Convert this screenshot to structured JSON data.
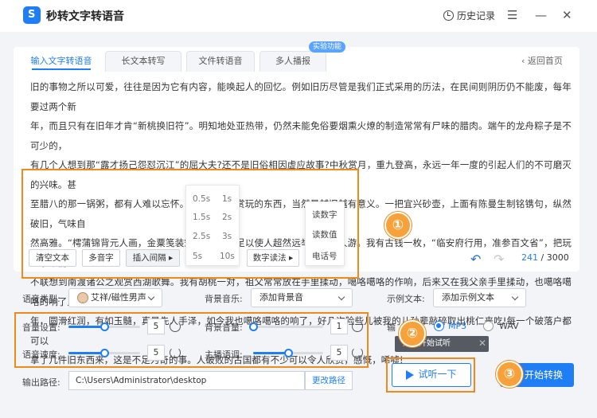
{
  "app": {
    "title": "秒转文字转语音",
    "logo_char": "S"
  },
  "header": {
    "history": "历史记录",
    "menu": "☰",
    "minimize": "—",
    "close": "✕"
  },
  "tabs": [
    {
      "label": "输入文字转语音"
    },
    {
      "label": "长文本转写"
    },
    {
      "label": "文件转语音"
    },
    {
      "label": "多人播报"
    }
  ],
  "badge": "实验功能",
  "back_home": "返回首页",
  "article": {
    "lines": [
      "旧的事物之所以可爱，往往是因为它有内容，能唤起人的回忆。例如旧历尽管是我们正式采用的历法，在民间则阴历仍不能废，每年要过两个新",
      "年，而且只有在旧年才肯“新桃换旧符”。明知地处亚热带，仍然未能免俗要烟熏火燎的制造常常有尸味的腊肉。端午的龙舟粽子是不可少的，",
      "有几个人想到那“露才扬己怨怼沉江”的屈大夫?还不是旧俗相因虚应故事?中秋赏月，重九登高，永远一年一度的引起人们的不可磨灭的兴味。甚",
      "至腊八的那一锅粥，都有人难以忘怀。至于供个人赏玩的东西，当然是越旧越有意义。一把宜兴砂壶，上面有陈曼生制铭镌句，纵然破旧，气味自",
      "然高雅。“樗蒲锦背元人画，金粟笺装宋版书”更是足以使人超然远举，与古人游。我有古钱一枚，“临安府行用，准参百文省”，把玩之余不能",
      "不联想到南渡诸公之观赏西湖歌舞。我有胡桃一对，祖父常常放在手里揉动，噶咯噶咯的作响，后来又在我父亲手里揉动，也噶咯噶咯的响了几十",
      "年，圆滑红润，有如玉髓，真是先人手泽，如今我也噶咯噶咯的响了，好几次险些儿被我的儿孙辈敲碎取出桃仁来吃!每一个破落户都可以",
      "拿了几件旧东西来，这是不足为奇的事。人破败的古国都有不少可以令人欣赏，感慨，唏嘘!"
    ]
  },
  "editor_buttons": {
    "clear": "清空文本",
    "polyphone": "多音字",
    "insert_pause": "插入间隔 ▸",
    "digit_read": "数字读法 ▸"
  },
  "pause_menu": {
    "items": [
      "0.5s",
      "1s",
      "1.5s",
      "2s",
      "2.5s",
      "3s",
      "5s",
      "10s"
    ]
  },
  "digit_menu": {
    "items": [
      "读数字",
      "读数值",
      "电话号"
    ]
  },
  "annotations": {
    "one": "①",
    "two": "②",
    "three": "③"
  },
  "editor_tools": {
    "undo": "↶",
    "redo": "↷",
    "count_current": "241",
    "count_max": " / 3000"
  },
  "voice": {
    "label": "语音类型:",
    "value": "艾祥/磁性男声"
  },
  "bgm": {
    "label": "背景音乐:",
    "value": "添加背景音"
  },
  "example": {
    "label": "示例文本:",
    "value": "添加示例文本"
  },
  "sliders": {
    "volume": {
      "label": "音量设置:",
      "value": "5",
      "fraction": 0.5
    },
    "speed": {
      "label": "语音速度:",
      "value": "5",
      "fraction": 0.5
    },
    "bg_volume": {
      "label": "背景音量:",
      "value": "1",
      "fraction": 0.0
    },
    "pitch": {
      "label": "主播语调:",
      "value": "5",
      "fraction": 0.5
    }
  },
  "format": {
    "label": "输",
    "mp3": "MP3",
    "wav": "WAV"
  },
  "tooltip": {
    "text": "点击开始试听",
    "close": "✕"
  },
  "listen_button": "试听一下",
  "convert_button": "开始转换",
  "output": {
    "label": "输出路径:",
    "path": "C:\\Users\\Administrator\\desktop",
    "change": "更改路径"
  }
}
